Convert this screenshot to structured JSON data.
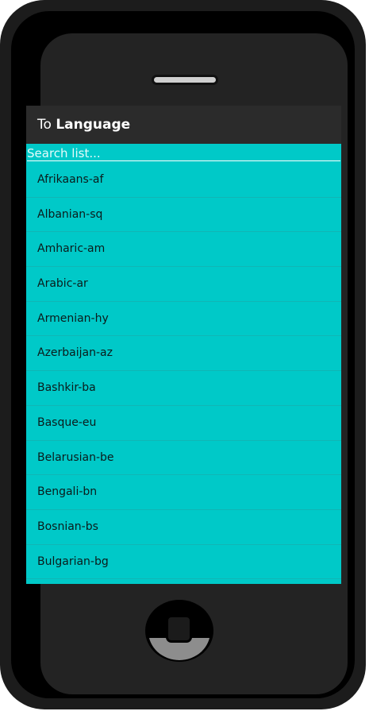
{
  "header": {
    "title_prefix": "To",
    "title_strong": "Language"
  },
  "search": {
    "placeholder": "Search list..."
  },
  "languages": [
    "Afrikaans-af",
    "Albanian-sq",
    "Amharic-am",
    "Arabic-ar",
    "Armenian-hy",
    "Azerbaijan-az",
    "Bashkir-ba",
    "Basque-eu",
    "Belarusian-be",
    "Bengali-bn",
    "Bosnian-bs",
    "Bulgarian-bg"
  ],
  "colors": {
    "screen": "#00c9c8",
    "titlebar": "#2b2b2b",
    "phone_body": "#1c1c1c"
  }
}
